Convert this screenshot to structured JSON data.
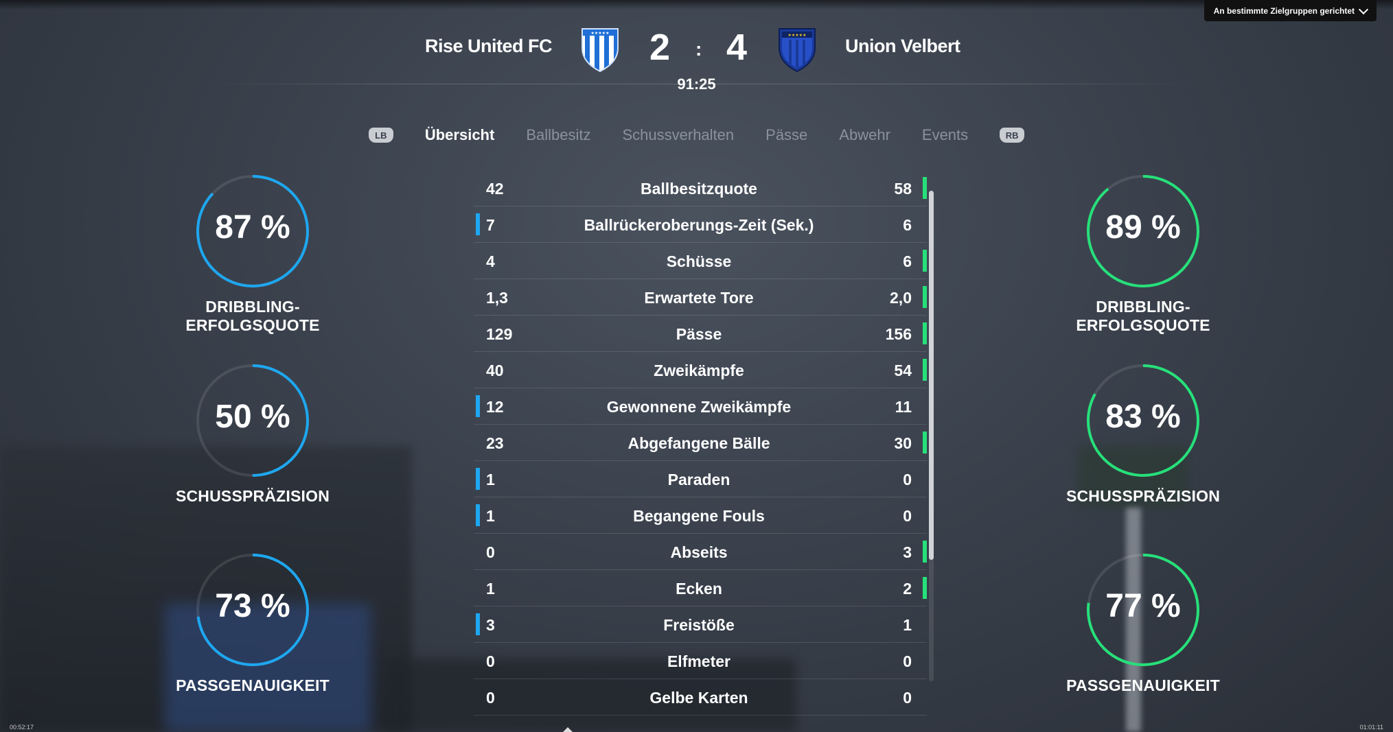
{
  "audience_button": {
    "label": "An bestimmte Zielgruppen gerichtet"
  },
  "match": {
    "home": {
      "name": "Rise United FC",
      "score": "2"
    },
    "away": {
      "name": "Union Velbert",
      "score": "4"
    },
    "separator": ":",
    "clock": "91:25"
  },
  "tabs": {
    "left_bumper": "LB",
    "right_bumper": "RB",
    "items": [
      "Übersicht",
      "Ballbesitz",
      "Schussverhalten",
      "Pässe",
      "Abwehr",
      "Events"
    ],
    "active": "Übersicht"
  },
  "home_gauges": [
    {
      "value": "87 %",
      "fraction": 0.87,
      "label": "DRIBBLING-ERFOLGSQUOTE"
    },
    {
      "value": "50 %",
      "fraction": 0.5,
      "label": "SCHUSSPRÄZISION"
    },
    {
      "value": "73 %",
      "fraction": 0.73,
      "label": "PASSGENAUIGKEIT"
    }
  ],
  "away_gauges": [
    {
      "value": "89 %",
      "fraction": 0.89,
      "label": "DRIBBLING-ERFOLGSQUOTE"
    },
    {
      "value": "83 %",
      "fraction": 0.83,
      "label": "SCHUSSPRÄZISION"
    },
    {
      "value": "77 %",
      "fraction": 0.77,
      "label": "PASSGENAUIGKEIT"
    }
  ],
  "stats": [
    {
      "home": "42",
      "name": "Ballbesitzquote",
      "away": "58",
      "leader": "away"
    },
    {
      "home": "7",
      "name": "Ballrückeroberungs-Zeit (Sek.)",
      "away": "6",
      "leader": "home"
    },
    {
      "home": "4",
      "name": "Schüsse",
      "away": "6",
      "leader": "away"
    },
    {
      "home": "1,3",
      "name": "Erwartete Tore",
      "away": "2,0",
      "leader": "away"
    },
    {
      "home": "129",
      "name": "Pässe",
      "away": "156",
      "leader": "away"
    },
    {
      "home": "40",
      "name": "Zweikämpfe",
      "away": "54",
      "leader": "away"
    },
    {
      "home": "12",
      "name": "Gewonnene Zweikämpfe",
      "away": "11",
      "leader": "home"
    },
    {
      "home": "23",
      "name": "Abgefangene Bälle",
      "away": "30",
      "leader": "away"
    },
    {
      "home": "1",
      "name": "Paraden",
      "away": "0",
      "leader": "home"
    },
    {
      "home": "1",
      "name": "Begangene Fouls",
      "away": "0",
      "leader": "home"
    },
    {
      "home": "0",
      "name": "Abseits",
      "away": "3",
      "leader": "away"
    },
    {
      "home": "1",
      "name": "Ecken",
      "away": "2",
      "leader": "away"
    },
    {
      "home": "3",
      "name": "Freistöße",
      "away": "1",
      "leader": "home"
    },
    {
      "home": "0",
      "name": "Elfmeter",
      "away": "0",
      "leader": "none"
    },
    {
      "home": "0",
      "name": "Gelbe Karten",
      "away": "0",
      "leader": "none"
    }
  ],
  "colors": {
    "home_accent": "#1ea7f0",
    "away_accent": "#26e07a"
  },
  "footer": {
    "left": "00:52:17",
    "right": "01:01:11"
  }
}
